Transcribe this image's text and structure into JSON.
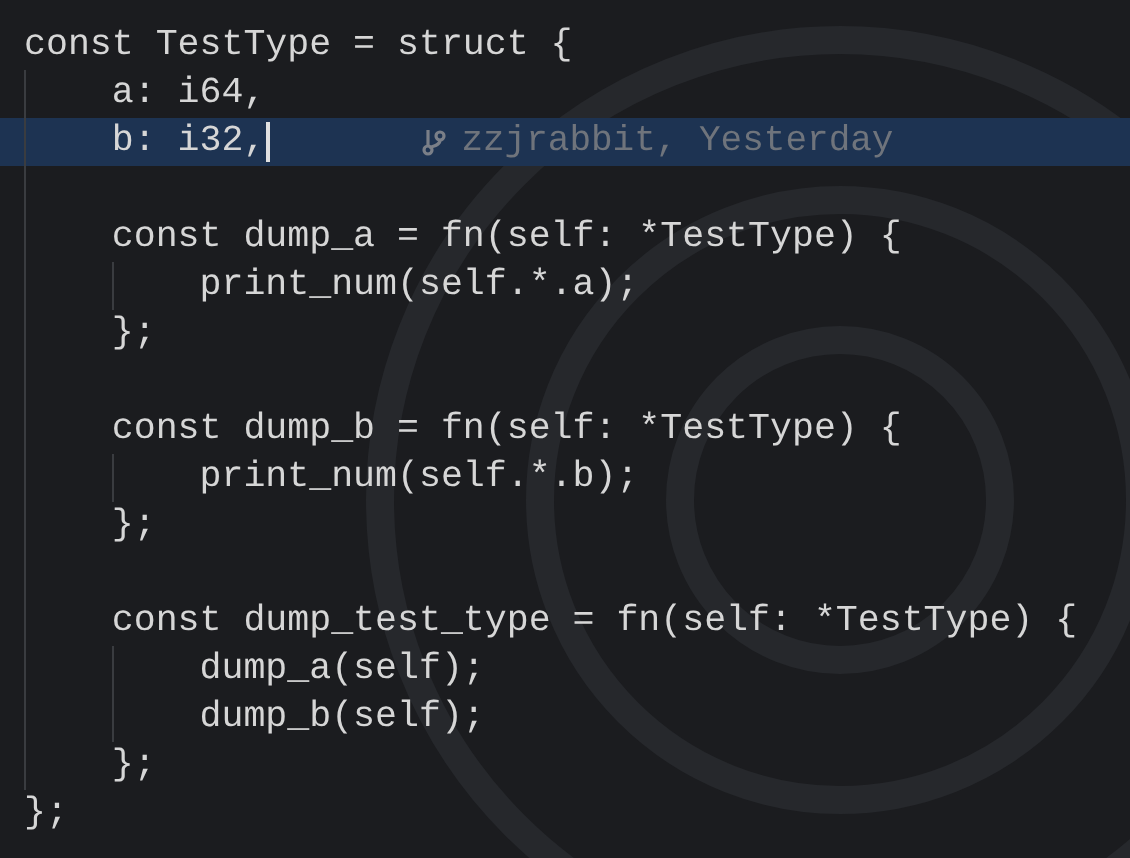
{
  "editor": {
    "lines": [
      {
        "kind": "code",
        "text": "const TestType = struct {",
        "selected": false
      },
      {
        "kind": "code",
        "text": "    a: i64,",
        "selected": false
      },
      {
        "kind": "code",
        "text": "    b: i32,",
        "selected": true,
        "blame": "zzjrabbit, Yesterday"
      },
      {
        "kind": "blank"
      },
      {
        "kind": "code",
        "text": "    const dump_a = fn(self: *TestType) {",
        "selected": false
      },
      {
        "kind": "code",
        "text": "        print_num(self.*.a);",
        "selected": false
      },
      {
        "kind": "code",
        "text": "    };",
        "selected": false
      },
      {
        "kind": "blank"
      },
      {
        "kind": "code",
        "text": "    const dump_b = fn(self: *TestType) {",
        "selected": false
      },
      {
        "kind": "code",
        "text": "        print_num(self.*.b);",
        "selected": false
      },
      {
        "kind": "code",
        "text": "    };",
        "selected": false
      },
      {
        "kind": "blank"
      },
      {
        "kind": "code",
        "text": "    const dump_test_type = fn(self: *TestType) {",
        "selected": false
      },
      {
        "kind": "code",
        "text": "        dump_a(self);",
        "selected": false
      },
      {
        "kind": "code",
        "text": "        dump_b(self);",
        "selected": false
      },
      {
        "kind": "code",
        "text": "    };",
        "selected": false
      },
      {
        "kind": "code",
        "text": "};",
        "selected": false
      }
    ]
  }
}
